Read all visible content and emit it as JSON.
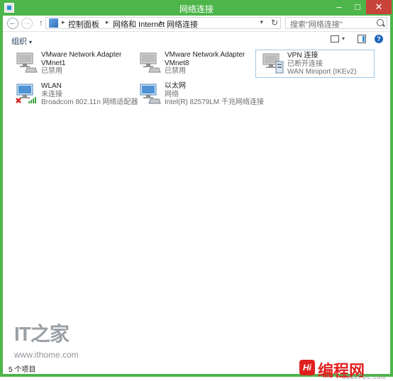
{
  "window": {
    "title": "网络连接",
    "accent": "#4db54a",
    "min_glyph": "–",
    "max_glyph": "□",
    "close_glyph": "✕"
  },
  "address": {
    "back_glyph": "←",
    "forward_glyph": "→",
    "up_glyph": "↑",
    "sep_glyph": "▸",
    "dropdown_glyph": "▾",
    "refresh_glyph": "↻",
    "crumbs": [
      "控制面板",
      "网络和 Internet",
      "网络连接"
    ],
    "search_placeholder": "搜索\"网络连接\""
  },
  "toolbar": {
    "organize_label": "组织",
    "caret_glyph": "▾",
    "help_glyph": "?"
  },
  "connections": [
    {
      "name": "VMware Network Adapter VMnet1",
      "name_line1": "VMware Network Adapter",
      "name_line2": "VMnet1",
      "status": "已禁用",
      "device": "",
      "icon": "network-adapter-disabled-icon",
      "selected": false
    },
    {
      "name": "VMware Network Adapter VMnet8",
      "name_line1": "VMware Network Adapter",
      "name_line2": "VMnet8",
      "status": "已禁用",
      "device": "",
      "icon": "network-adapter-disabled-icon",
      "selected": false
    },
    {
      "name": "VPN 连接",
      "name_line1": "VPN 连接",
      "name_line2": "",
      "status": "已断开连接",
      "device": "WAN Miniport (IKEv2)",
      "icon": "vpn-icon",
      "selected": true
    },
    {
      "name": "WLAN",
      "name_line1": "WLAN",
      "name_line2": "",
      "status": "未连接",
      "device": "Broadcom 802.11n 网络适配器",
      "icon": "wlan-icon",
      "selected": false
    },
    {
      "name": "以太网",
      "name_line1": "以太网",
      "name_line2": "",
      "status": "网络",
      "device": "Intel(R) 82579LM 千兆网络连接",
      "icon": "ethernet-icon",
      "selected": false
    }
  ],
  "statusbar": {
    "count": "5 个项目"
  },
  "watermark": {
    "logo": "IT之家",
    "url": "www.ithome.com"
  },
  "brand": {
    "logo": "Hi",
    "text": "编程网",
    "url": "CodeFUL.com"
  }
}
